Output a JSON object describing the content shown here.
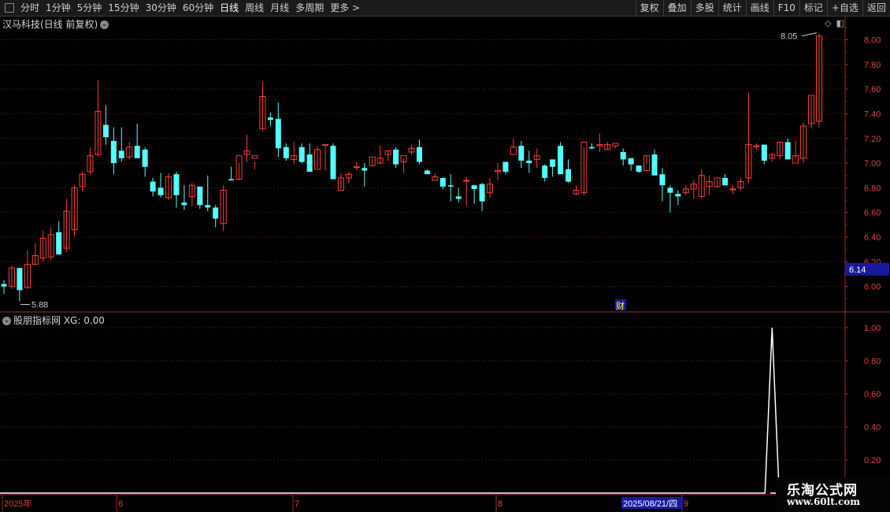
{
  "toolbar": {
    "periods": [
      "分时",
      "1分钟",
      "5分钟",
      "15分钟",
      "30分钟",
      "60分钟",
      "日线",
      "周线",
      "月线",
      "多周期",
      "更多 >"
    ],
    "active_period": "日线",
    "tools": [
      "复权",
      "叠加",
      "多股",
      "统计",
      "画线",
      "F10",
      "标记",
      "+自选",
      "返回"
    ]
  },
  "chart": {
    "title": "汉马科技(日线 前复权)",
    "price_axis": [
      "8.00",
      "7.80",
      "7.60",
      "7.40",
      "7.20",
      "7.00",
      "6.80",
      "6.60",
      "6.40",
      "6.20",
      "6.00"
    ],
    "current_price": "6.14",
    "max_label": "8.05",
    "min_label": "5.88",
    "finance_marker": "财"
  },
  "indicator": {
    "title": "股朋指标网 XG: 0.00",
    "axis": [
      "1.00",
      "0.80",
      "0.60",
      "0.40",
      "0.20"
    ]
  },
  "time_axis": {
    "labels": [
      "2025年",
      "6",
      "7",
      "8",
      "9"
    ],
    "cursor_date": "2025/08/21/四"
  },
  "watermark": {
    "line1": "乐淘公式网",
    "line2": "www.60lt.com"
  },
  "colors": {
    "up": "#ff3b3b",
    "down": "#54ffff",
    "grid": "#7a1a1a",
    "axis": "#9a2a2a"
  },
  "chart_data": [
    {
      "type": "candlestick",
      "title": "汉马科技(日线 前复权)",
      "ylim": [
        5.8,
        8.15
      ],
      "ohlc": [
        [
          6.02,
          6.05,
          5.94,
          6.0
        ],
        [
          6.0,
          6.17,
          5.98,
          6.15
        ],
        [
          6.15,
          6.15,
          5.88,
          5.97
        ],
        [
          5.99,
          6.29,
          5.99,
          6.18
        ],
        [
          6.18,
          6.35,
          6.18,
          6.25
        ],
        [
          6.23,
          6.45,
          6.2,
          6.39
        ],
        [
          6.24,
          6.48,
          6.22,
          6.42
        ],
        [
          6.44,
          6.53,
          6.26,
          6.26
        ],
        [
          6.31,
          6.71,
          6.28,
          6.61
        ],
        [
          6.46,
          6.82,
          6.41,
          6.8
        ],
        [
          6.81,
          6.93,
          6.77,
          6.91
        ],
        [
          6.93,
          7.13,
          6.91,
          7.06
        ],
        [
          7.07,
          7.67,
          7.05,
          7.42
        ],
        [
          7.31,
          7.47,
          7.15,
          7.21
        ],
        [
          7.18,
          7.29,
          6.91,
          7.0
        ],
        [
          7.1,
          7.29,
          7.01,
          7.04
        ],
        [
          7.05,
          7.17,
          7.03,
          7.13
        ],
        [
          7.14,
          7.32,
          7.06,
          7.04
        ],
        [
          7.11,
          7.13,
          6.89,
          6.97
        ],
        [
          6.85,
          6.88,
          6.73,
          6.77
        ],
        [
          6.8,
          6.92,
          6.72,
          6.74
        ],
        [
          6.72,
          6.92,
          6.7,
          6.89
        ],
        [
          6.91,
          6.93,
          6.64,
          6.74
        ],
        [
          6.68,
          6.82,
          6.62,
          6.66
        ],
        [
          6.73,
          6.84,
          6.65,
          6.82
        ],
        [
          6.81,
          6.81,
          6.63,
          6.66
        ],
        [
          6.66,
          6.9,
          6.61,
          6.64
        ],
        [
          6.64,
          6.66,
          6.48,
          6.55
        ],
        [
          6.51,
          6.82,
          6.45,
          6.78
        ],
        [
          6.87,
          6.97,
          6.86,
          6.86
        ],
        [
          6.87,
          7.0,
          6.86,
          7.06
        ],
        [
          7.07,
          7.23,
          7.01,
          7.1
        ],
        [
          7.04,
          7.01,
          6.95,
          7.06
        ],
        [
          7.28,
          7.66,
          7.26,
          7.54
        ],
        [
          7.37,
          7.41,
          7.3,
          7.35
        ],
        [
          7.36,
          7.49,
          7.05,
          7.12
        ],
        [
          7.13,
          7.16,
          7.02,
          7.04
        ],
        [
          7.03,
          7.17,
          6.99,
          7.06
        ],
        [
          7.13,
          7.16,
          7.0,
          7.01
        ],
        [
          7.07,
          7.16,
          6.93,
          6.93
        ],
        [
          6.95,
          7.14,
          6.96,
          7.11
        ],
        [
          7.15,
          7.14,
          6.94,
          7.15
        ],
        [
          7.14,
          7.16,
          6.87,
          6.87
        ],
        [
          6.78,
          6.92,
          6.79,
          6.88
        ],
        [
          6.88,
          6.93,
          6.84,
          6.91
        ],
        [
          6.97,
          7.01,
          6.94,
          6.97
        ],
        [
          6.96,
          7.0,
          6.81,
          6.94
        ],
        [
          6.98,
          7.04,
          6.98,
          7.05
        ],
        [
          7.0,
          7.14,
          6.99,
          7.04
        ],
        [
          7.07,
          7.1,
          7.02,
          7.1
        ],
        [
          7.11,
          7.13,
          6.96,
          6.99
        ],
        [
          7.01,
          7.04,
          6.92,
          7.06
        ],
        [
          7.09,
          7.15,
          7.07,
          7.12
        ],
        [
          7.13,
          7.19,
          6.99,
          7.01
        ],
        [
          6.94,
          6.95,
          6.91,
          6.91
        ],
        [
          6.86,
          6.92,
          6.88,
          6.89
        ],
        [
          6.88,
          6.86,
          6.79,
          6.81
        ],
        [
          6.82,
          6.91,
          6.69,
          6.81
        ],
        [
          6.73,
          6.8,
          6.68,
          6.71
        ],
        [
          6.86,
          6.89,
          6.66,
          6.86
        ],
        [
          6.82,
          6.82,
          6.67,
          6.79
        ],
        [
          6.83,
          6.84,
          6.61,
          6.69
        ],
        [
          6.76,
          6.88,
          6.72,
          6.83
        ],
        [
          6.93,
          7.0,
          6.86,
          6.94
        ],
        [
          7.01,
          7.01,
          6.91,
          6.93
        ],
        [
          7.07,
          7.2,
          7.12,
          7.13
        ],
        [
          7.14,
          7.18,
          6.96,
          7.02
        ],
        [
          7.02,
          7.1,
          6.92,
          7.0
        ],
        [
          7.03,
          7.12,
          6.96,
          7.06
        ],
        [
          6.98,
          6.99,
          6.85,
          6.88
        ],
        [
          7.03,
          7.03,
          6.89,
          6.97
        ],
        [
          7.14,
          7.17,
          6.95,
          6.91
        ],
        [
          6.95,
          7.03,
          6.84,
          6.85
        ],
        [
          6.75,
          6.82,
          6.74,
          6.78
        ],
        [
          6.76,
          7.13,
          6.74,
          7.17
        ],
        [
          7.13,
          7.16,
          7.11,
          7.12
        ],
        [
          7.14,
          7.24,
          7.09,
          7.15
        ],
        [
          7.11,
          7.17,
          7.11,
          7.15
        ],
        [
          7.14,
          7.14,
          7.12,
          7.16
        ],
        [
          7.09,
          7.12,
          6.98,
          7.03
        ],
        [
          7.04,
          7.04,
          6.94,
          6.99
        ],
        [
          6.98,
          6.98,
          6.92,
          6.93
        ],
        [
          6.94,
          7.06,
          6.99,
          7.06
        ],
        [
          7.07,
          7.11,
          6.91,
          6.9
        ],
        [
          6.91,
          6.96,
          6.69,
          6.82
        ],
        [
          6.8,
          6.82,
          6.6,
          6.76
        ],
        [
          6.75,
          6.78,
          6.66,
          6.73
        ],
        [
          6.76,
          6.82,
          6.74,
          6.79
        ],
        [
          6.79,
          6.86,
          6.71,
          6.83
        ],
        [
          6.73,
          6.95,
          6.71,
          6.9
        ],
        [
          6.81,
          6.9,
          6.74,
          6.85
        ],
        [
          6.81,
          6.87,
          6.8,
          6.88
        ],
        [
          6.88,
          6.91,
          6.82,
          6.82
        ],
        [
          6.79,
          6.82,
          6.75,
          6.79
        ],
        [
          6.8,
          6.88,
          6.78,
          6.85
        ],
        [
          6.88,
          7.57,
          6.84,
          7.15
        ],
        [
          7.14,
          7.16,
          7.11,
          7.14
        ],
        [
          7.15,
          7.14,
          6.99,
          7.02
        ],
        [
          7.04,
          7.08,
          7.01,
          7.07
        ],
        [
          7.06,
          7.17,
          7.03,
          7.17
        ],
        [
          7.17,
          7.2,
          7.03,
          7.03
        ],
        [
          7.0,
          7.18,
          7.04,
          7.06
        ],
        [
          7.04,
          7.33,
          7.0,
          7.3
        ],
        [
          7.32,
          7.54,
          7.28,
          7.55
        ],
        [
          7.34,
          8.05,
          7.29,
          8.03
        ]
      ]
    },
    {
      "type": "line",
      "title": "股朋指标网 XG: 0.00",
      "ylim": [
        0,
        1.0
      ],
      "spike_index": 98,
      "values_note_index_range": [
        0,
        102
      ]
    }
  ]
}
